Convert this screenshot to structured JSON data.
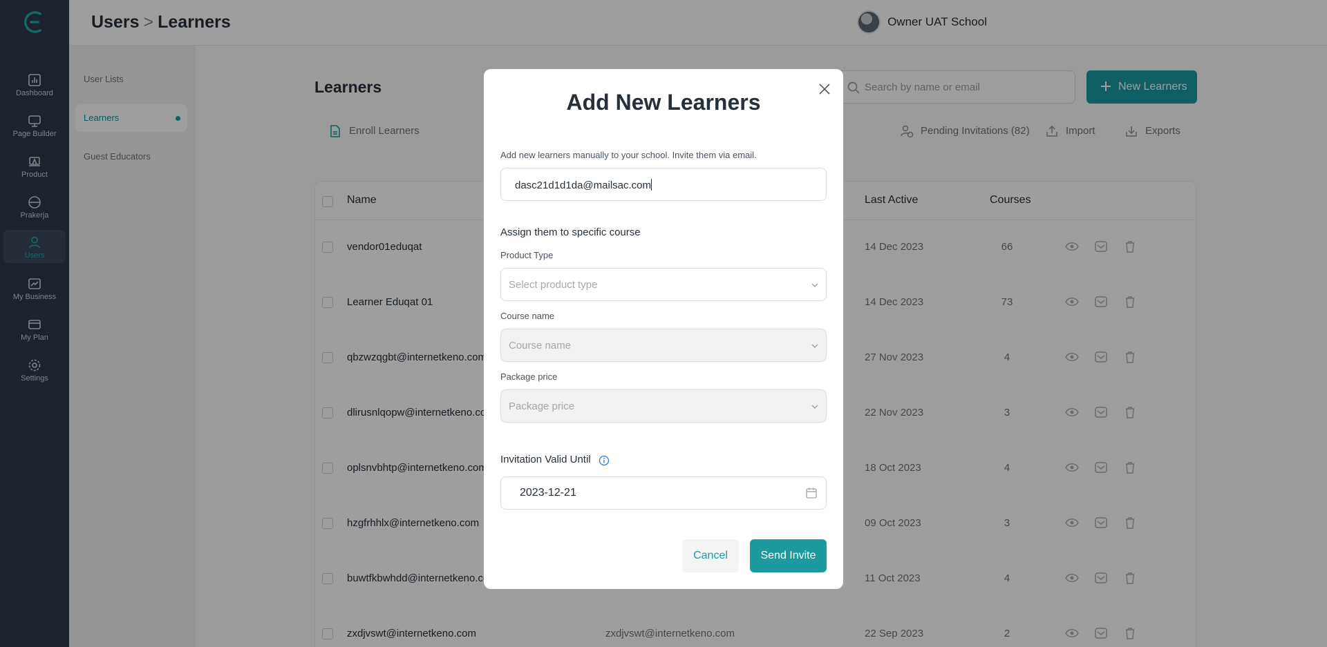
{
  "header": {
    "breadcrumb_parent": "Users",
    "breadcrumb_separator": ">",
    "breadcrumb_current": "Learners",
    "user_name": "Owner UAT School"
  },
  "rail": {
    "items": [
      {
        "label": "Dashboard",
        "icon": "dashboard-icon"
      },
      {
        "label": "Page Builder",
        "icon": "monitor-icon"
      },
      {
        "label": "Product",
        "icon": "product-icon"
      },
      {
        "label": "Prakerja",
        "icon": "box-icon"
      },
      {
        "label": "Users",
        "icon": "user-icon",
        "active": true
      },
      {
        "label": "My Business",
        "icon": "chart-icon"
      },
      {
        "label": "My Plan",
        "icon": "card-icon"
      },
      {
        "label": "Settings",
        "icon": "gear-icon"
      }
    ]
  },
  "subnav": {
    "items": [
      {
        "label": "User Lists"
      },
      {
        "label": "Learners",
        "active": true
      },
      {
        "label": "Guest Educators"
      }
    ]
  },
  "main": {
    "title": "Learners",
    "search_placeholder": "Search by name or email",
    "new_button": "New Learners",
    "enroll": "Enroll Learners",
    "pending": "Pending Invitations (82)",
    "import": "Import",
    "exports": "Exports"
  },
  "table": {
    "headers": {
      "name": "Name",
      "last_active": "Last Active",
      "courses": "Courses"
    },
    "rows": [
      {
        "name": "vendor01eduqat",
        "email": "",
        "last_active": "14 Dec 2023",
        "courses": "66"
      },
      {
        "name": "Learner Eduqat 01",
        "email": "",
        "last_active": "14 Dec 2023",
        "courses": "73"
      },
      {
        "name": "qbzwzqgbt@internetkeno.com",
        "email": "",
        "last_active": "27 Nov 2023",
        "courses": "4"
      },
      {
        "name": "dlirusnlqopw@internetkeno.com",
        "email": "",
        "last_active": "22 Nov 2023",
        "courses": "3"
      },
      {
        "name": "oplsnvbhtp@internetkeno.com",
        "email": "",
        "last_active": "18 Oct 2023",
        "courses": "4"
      },
      {
        "name": "hzgfrhhlx@internetkeno.com",
        "email": "",
        "last_active": "09 Oct 2023",
        "courses": "3"
      },
      {
        "name": "buwtfkbwhdd@internetkeno.com",
        "email": "",
        "last_active": "11 Oct 2023",
        "courses": "4"
      },
      {
        "name": "zxdjvswt@internetkeno.com",
        "email": "zxdjvswt@internetkeno.com",
        "last_active": "22 Sep 2023",
        "courses": "2"
      }
    ]
  },
  "modal": {
    "title": "Add New Learners",
    "description": "Add new learners manually to your school. Invite them via email.",
    "email_value": "dasc21d1d1da@mailsac.com",
    "assign_heading": "Assign them to specific course",
    "product_type_label": "Product Type",
    "product_type_placeholder": "Select product type",
    "course_label": "Course name",
    "course_placeholder": "Course name",
    "package_label": "Package price",
    "package_placeholder": "Package price",
    "valid_until_label": "Invitation Valid Until",
    "valid_until_value": "2023-12-21",
    "cancel": "Cancel",
    "send": "Send Invite"
  },
  "colors": {
    "accent": "#1b9aa0",
    "rail": "#2c3947"
  }
}
